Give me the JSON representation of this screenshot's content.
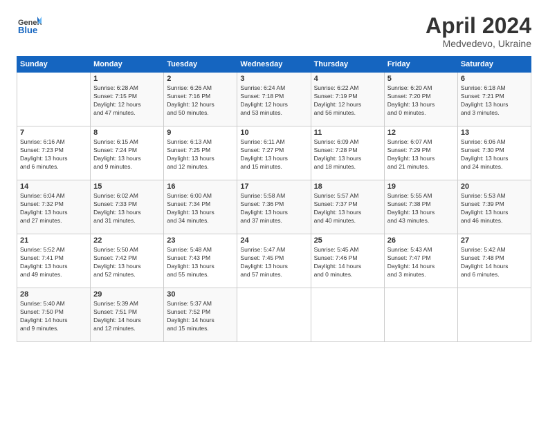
{
  "header": {
    "logo_general": "General",
    "logo_blue": "Blue",
    "title": "April 2024",
    "location": "Medvedevo, Ukraine"
  },
  "calendar": {
    "days_of_week": [
      "Sunday",
      "Monday",
      "Tuesday",
      "Wednesday",
      "Thursday",
      "Friday",
      "Saturday"
    ],
    "weeks": [
      [
        {
          "num": "",
          "info": ""
        },
        {
          "num": "1",
          "info": "Sunrise: 6:28 AM\nSunset: 7:15 PM\nDaylight: 12 hours\nand 47 minutes."
        },
        {
          "num": "2",
          "info": "Sunrise: 6:26 AM\nSunset: 7:16 PM\nDaylight: 12 hours\nand 50 minutes."
        },
        {
          "num": "3",
          "info": "Sunrise: 6:24 AM\nSunset: 7:18 PM\nDaylight: 12 hours\nand 53 minutes."
        },
        {
          "num": "4",
          "info": "Sunrise: 6:22 AM\nSunset: 7:19 PM\nDaylight: 12 hours\nand 56 minutes."
        },
        {
          "num": "5",
          "info": "Sunrise: 6:20 AM\nSunset: 7:20 PM\nDaylight: 13 hours\nand 0 minutes."
        },
        {
          "num": "6",
          "info": "Sunrise: 6:18 AM\nSunset: 7:21 PM\nDaylight: 13 hours\nand 3 minutes."
        }
      ],
      [
        {
          "num": "7",
          "info": "Sunrise: 6:16 AM\nSunset: 7:23 PM\nDaylight: 13 hours\nand 6 minutes."
        },
        {
          "num": "8",
          "info": "Sunrise: 6:15 AM\nSunset: 7:24 PM\nDaylight: 13 hours\nand 9 minutes."
        },
        {
          "num": "9",
          "info": "Sunrise: 6:13 AM\nSunset: 7:25 PM\nDaylight: 13 hours\nand 12 minutes."
        },
        {
          "num": "10",
          "info": "Sunrise: 6:11 AM\nSunset: 7:27 PM\nDaylight: 13 hours\nand 15 minutes."
        },
        {
          "num": "11",
          "info": "Sunrise: 6:09 AM\nSunset: 7:28 PM\nDaylight: 13 hours\nand 18 minutes."
        },
        {
          "num": "12",
          "info": "Sunrise: 6:07 AM\nSunset: 7:29 PM\nDaylight: 13 hours\nand 21 minutes."
        },
        {
          "num": "13",
          "info": "Sunrise: 6:06 AM\nSunset: 7:30 PM\nDaylight: 13 hours\nand 24 minutes."
        }
      ],
      [
        {
          "num": "14",
          "info": "Sunrise: 6:04 AM\nSunset: 7:32 PM\nDaylight: 13 hours\nand 27 minutes."
        },
        {
          "num": "15",
          "info": "Sunrise: 6:02 AM\nSunset: 7:33 PM\nDaylight: 13 hours\nand 31 minutes."
        },
        {
          "num": "16",
          "info": "Sunrise: 6:00 AM\nSunset: 7:34 PM\nDaylight: 13 hours\nand 34 minutes."
        },
        {
          "num": "17",
          "info": "Sunrise: 5:58 AM\nSunset: 7:36 PM\nDaylight: 13 hours\nand 37 minutes."
        },
        {
          "num": "18",
          "info": "Sunrise: 5:57 AM\nSunset: 7:37 PM\nDaylight: 13 hours\nand 40 minutes."
        },
        {
          "num": "19",
          "info": "Sunrise: 5:55 AM\nSunset: 7:38 PM\nDaylight: 13 hours\nand 43 minutes."
        },
        {
          "num": "20",
          "info": "Sunrise: 5:53 AM\nSunset: 7:39 PM\nDaylight: 13 hours\nand 46 minutes."
        }
      ],
      [
        {
          "num": "21",
          "info": "Sunrise: 5:52 AM\nSunset: 7:41 PM\nDaylight: 13 hours\nand 49 minutes."
        },
        {
          "num": "22",
          "info": "Sunrise: 5:50 AM\nSunset: 7:42 PM\nDaylight: 13 hours\nand 52 minutes."
        },
        {
          "num": "23",
          "info": "Sunrise: 5:48 AM\nSunset: 7:43 PM\nDaylight: 13 hours\nand 55 minutes."
        },
        {
          "num": "24",
          "info": "Sunrise: 5:47 AM\nSunset: 7:45 PM\nDaylight: 13 hours\nand 57 minutes."
        },
        {
          "num": "25",
          "info": "Sunrise: 5:45 AM\nSunset: 7:46 PM\nDaylight: 14 hours\nand 0 minutes."
        },
        {
          "num": "26",
          "info": "Sunrise: 5:43 AM\nSunset: 7:47 PM\nDaylight: 14 hours\nand 3 minutes."
        },
        {
          "num": "27",
          "info": "Sunrise: 5:42 AM\nSunset: 7:48 PM\nDaylight: 14 hours\nand 6 minutes."
        }
      ],
      [
        {
          "num": "28",
          "info": "Sunrise: 5:40 AM\nSunset: 7:50 PM\nDaylight: 14 hours\nand 9 minutes."
        },
        {
          "num": "29",
          "info": "Sunrise: 5:39 AM\nSunset: 7:51 PM\nDaylight: 14 hours\nand 12 minutes."
        },
        {
          "num": "30",
          "info": "Sunrise: 5:37 AM\nSunset: 7:52 PM\nDaylight: 14 hours\nand 15 minutes."
        },
        {
          "num": "",
          "info": ""
        },
        {
          "num": "",
          "info": ""
        },
        {
          "num": "",
          "info": ""
        },
        {
          "num": "",
          "info": ""
        }
      ]
    ]
  }
}
